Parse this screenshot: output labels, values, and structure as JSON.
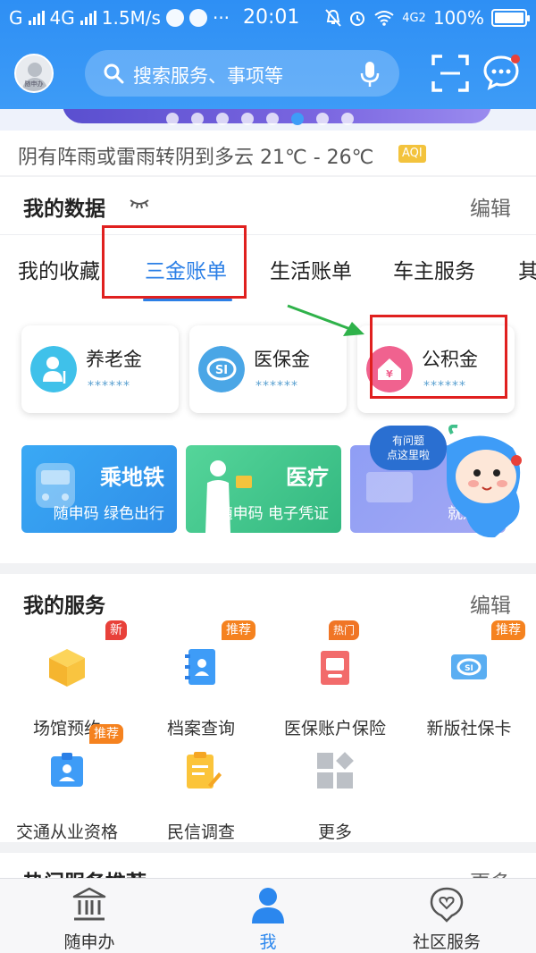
{
  "status_bar": {
    "carrier_left": "G",
    "network": "4G",
    "speed": "1.5M/s",
    "time": "20:01",
    "network_right": "4G2",
    "battery": "100%"
  },
  "header": {
    "avatar_caption": "随申办",
    "search_placeholder": "搜索服务、事项等"
  },
  "banner": {
    "dot_count": 8,
    "active_dot": 5
  },
  "weather": {
    "text": "阴有阵雨或雷雨转阴到多云 21℃ - 26℃",
    "aqi": "AQI"
  },
  "my_data": {
    "title": "我的数据",
    "edit": "编辑",
    "tabs": [
      "我的收藏",
      "三金账单",
      "生活账单",
      "车主服务",
      "其"
    ],
    "active_tab": 1,
    "funds": [
      {
        "name": "养老金",
        "mask": "******",
        "color": "#3fc1ea"
      },
      {
        "name": "医保金",
        "mask": "******",
        "color": "#4aa6e6"
      },
      {
        "name": "公积金",
        "mask": "******",
        "color": "#f0628f"
      }
    ],
    "promos": [
      {
        "title": "乘地铁",
        "sub": "随申码 绿色出行"
      },
      {
        "title": "医疗",
        "sub": "随申码 电子凭证"
      },
      {
        "title": "",
        "sub": "就近办"
      }
    ],
    "help_bubble": [
      "有问题",
      "点这里啦"
    ]
  },
  "services": {
    "title": "我的服务",
    "edit": "编辑",
    "items": [
      {
        "label": "场馆预约",
        "badge": "新",
        "icon": "box-icon"
      },
      {
        "label": "档案查询",
        "badge": "推荐",
        "icon": "archive-icon"
      },
      {
        "label": "医保账户保险",
        "badge": "热门",
        "icon": "insurance-icon"
      },
      {
        "label": "新版社保卡",
        "badge": "推荐",
        "icon": "social-card-icon"
      },
      {
        "label": "交通从业资格",
        "badge": "推荐",
        "icon": "badge-id-icon"
      },
      {
        "label": "民信调查",
        "badge": "",
        "icon": "survey-icon"
      },
      {
        "label": "更多",
        "badge": "",
        "icon": "more-grid-icon"
      }
    ]
  },
  "next_section": {
    "title": "热门服务推荐",
    "more": "更多"
  },
  "bottom_nav": [
    {
      "label": "随申办",
      "icon": "government-building-icon"
    },
    {
      "label": "我",
      "icon": "person-icon",
      "active": true
    },
    {
      "label": "社区服务",
      "icon": "heart-chat-icon"
    }
  ],
  "colors": {
    "primary": "#3e9cf7",
    "accent": "#2b7fe6",
    "highlight_box": "#e0201f",
    "arrow": "#2fb24a"
  }
}
